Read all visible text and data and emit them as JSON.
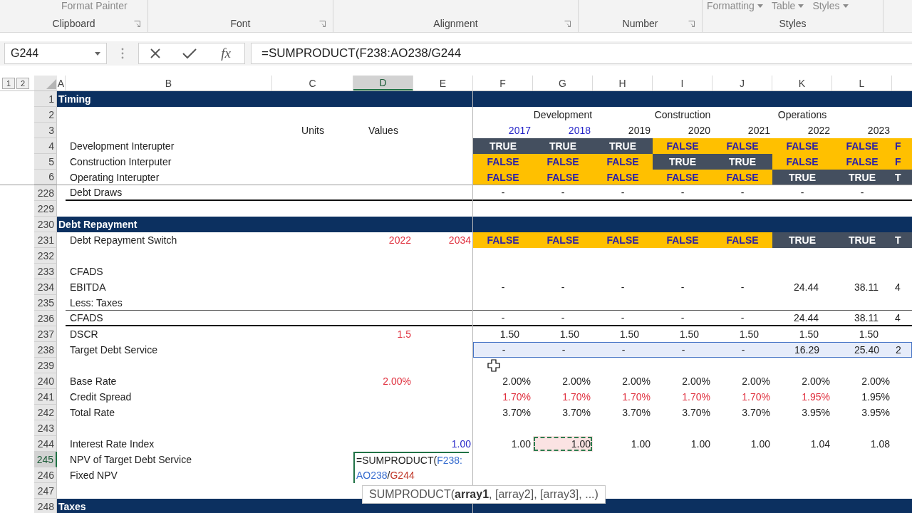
{
  "ribbon": {
    "groups": [
      {
        "label": "Clipboard",
        "launcher": true,
        "items": [
          {
            "label": "Format Painter",
            "dropdown": false
          }
        ]
      },
      {
        "label": "Font",
        "launcher": true
      },
      {
        "label": "Alignment",
        "launcher": true
      },
      {
        "label": "Number",
        "launcher": true
      },
      {
        "label": "Styles",
        "launcher": false,
        "items": [
          {
            "label": "Formatting",
            "dropdown": true
          },
          {
            "label": "Table",
            "dropdown": true
          },
          {
            "label": "Styles",
            "dropdown": true
          }
        ]
      }
    ]
  },
  "formula_bar": {
    "name_box": "G244",
    "function_label": "fx",
    "formula": "=SUMPRODUCT(F238:AO238/G244"
  },
  "outline_levels": [
    "1",
    "2"
  ],
  "columns": [
    {
      "label": "A",
      "selected": false
    },
    {
      "label": "B",
      "selected": false
    },
    {
      "label": "C",
      "selected": false
    },
    {
      "label": "D",
      "selected": true
    },
    {
      "label": "E",
      "selected": false
    },
    {
      "label": "F",
      "selected": false
    },
    {
      "label": "G",
      "selected": false
    },
    {
      "label": "H",
      "selected": false
    },
    {
      "label": "I",
      "selected": false
    },
    {
      "label": "J",
      "selected": false
    },
    {
      "label": "K",
      "selected": false
    },
    {
      "label": "L",
      "selected": false
    }
  ],
  "rows": [
    {
      "number": "1",
      "kind": "section",
      "label": "Timing",
      "selected": false,
      "in_range": false
    },
    {
      "number": "2",
      "kind": "phases",
      "selected": false,
      "in_range": false,
      "phases": [
        "Development",
        "Construction",
        "Operations"
      ]
    },
    {
      "number": "3",
      "kind": "data",
      "units": "Units",
      "d": {
        "text": "Values",
        "kind": "plain"
      },
      "selected": false,
      "in_range": false,
      "values": [
        {
          "text": "2017",
          "kind": "link"
        },
        {
          "text": "2018",
          "kind": "link"
        },
        {
          "text": "2019",
          "kind": "plain"
        },
        {
          "text": "2020",
          "kind": "plain"
        },
        {
          "text": "2021",
          "kind": "plain"
        },
        {
          "text": "2022",
          "kind": "plain"
        },
        {
          "text": "2023",
          "kind": "plain"
        }
      ]
    },
    {
      "number": "4",
      "kind": "data",
      "label": "Development Interupter",
      "selected": false,
      "in_range": false,
      "values": [
        {
          "text": "TRUE",
          "kind": "on"
        },
        {
          "text": "TRUE",
          "kind": "on"
        },
        {
          "text": "TRUE",
          "kind": "on"
        },
        {
          "text": "FALSE",
          "kind": "off"
        },
        {
          "text": "FALSE",
          "kind": "off"
        },
        {
          "text": "FALSE",
          "kind": "off"
        },
        {
          "text": "FALSE",
          "kind": "off"
        },
        {
          "text": "F",
          "kind": "off"
        }
      ]
    },
    {
      "number": "5",
      "kind": "data",
      "label": "Construction Interputer",
      "selected": false,
      "in_range": false,
      "values": [
        {
          "text": "FALSE",
          "kind": "off"
        },
        {
          "text": "FALSE",
          "kind": "off"
        },
        {
          "text": "FALSE",
          "kind": "off"
        },
        {
          "text": "TRUE",
          "kind": "on"
        },
        {
          "text": "TRUE",
          "kind": "on"
        },
        {
          "text": "FALSE",
          "kind": "off"
        },
        {
          "text": "FALSE",
          "kind": "off"
        },
        {
          "text": "F",
          "kind": "off"
        }
      ]
    },
    {
      "number": "6",
      "kind": "data",
      "label": "Operating Interupter",
      "selected": false,
      "in_range": false,
      "values": [
        {
          "text": "FALSE",
          "kind": "off"
        },
        {
          "text": "FALSE",
          "kind": "off"
        },
        {
          "text": "FALSE",
          "kind": "off"
        },
        {
          "text": "FALSE",
          "kind": "off"
        },
        {
          "text": "FALSE",
          "kind": "off"
        },
        {
          "text": "TRUE",
          "kind": "on"
        },
        {
          "text": "TRUE",
          "kind": "on"
        },
        {
          "text": "T",
          "kind": "on"
        }
      ]
    },
    {
      "number": "228",
      "kind": "total",
      "label": "Debt Draws",
      "selected": false,
      "in_range": false,
      "values": [
        {
          "text": "-",
          "kind": "nil"
        },
        {
          "text": "-",
          "kind": "nil"
        },
        {
          "text": "-",
          "kind": "nil"
        },
        {
          "text": "-",
          "kind": "nil"
        },
        {
          "text": "-",
          "kind": "nil"
        },
        {
          "text": "-",
          "kind": "nil"
        },
        {
          "text": "-",
          "kind": "nil"
        }
      ]
    },
    {
      "number": "229",
      "kind": "data",
      "selected": false,
      "in_range": false
    },
    {
      "number": "230",
      "kind": "section",
      "label": "Debt Repayment",
      "selected": false,
      "in_range": false
    },
    {
      "number": "231",
      "kind": "data",
      "label": "Debt Repayment Switch",
      "d": {
        "text": "2022",
        "kind": "input"
      },
      "e": {
        "text": "2034",
        "kind": "input"
      },
      "selected": false,
      "in_range": false,
      "values": [
        {
          "text": "FALSE",
          "kind": "off"
        },
        {
          "text": "FALSE",
          "kind": "off"
        },
        {
          "text": "FALSE",
          "kind": "off"
        },
        {
          "text": "FALSE",
          "kind": "off"
        },
        {
          "text": "FALSE",
          "kind": "off"
        },
        {
          "text": "TRUE",
          "kind": "on"
        },
        {
          "text": "TRUE",
          "kind": "on"
        },
        {
          "text": "T",
          "kind": "on"
        }
      ]
    },
    {
      "number": "232",
      "kind": "data",
      "selected": false,
      "in_range": false
    },
    {
      "number": "233",
      "kind": "data",
      "label": "CFADS",
      "selected": false,
      "in_range": false
    },
    {
      "number": "234",
      "kind": "data",
      "label": "EBITDA",
      "selected": false,
      "in_range": false,
      "values": [
        {
          "text": "-",
          "kind": "nil"
        },
        {
          "text": "-",
          "kind": "nil"
        },
        {
          "text": "-",
          "kind": "nil"
        },
        {
          "text": "-",
          "kind": "nil"
        },
        {
          "text": "-",
          "kind": "nil"
        },
        {
          "text": "24.44",
          "kind": "num"
        },
        {
          "text": "38.11",
          "kind": "num"
        },
        {
          "text": "4",
          "kind": "num"
        }
      ]
    },
    {
      "number": "235",
      "kind": "subtotal",
      "label": "Less: Taxes",
      "selected": false,
      "in_range": false
    },
    {
      "number": "236",
      "kind": "total",
      "label": "CFADS",
      "selected": false,
      "in_range": false,
      "values": [
        {
          "text": "-",
          "kind": "nil"
        },
        {
          "text": "-",
          "kind": "nil"
        },
        {
          "text": "-",
          "kind": "nil"
        },
        {
          "text": "-",
          "kind": "nil"
        },
        {
          "text": "-",
          "kind": "nil"
        },
        {
          "text": "24.44",
          "kind": "num"
        },
        {
          "text": "38.11",
          "kind": "num"
        },
        {
          "text": "4",
          "kind": "num"
        }
      ]
    },
    {
      "number": "237",
      "kind": "data",
      "label": "DSCR",
      "d": {
        "text": "1.5",
        "kind": "input"
      },
      "selected": false,
      "in_range": false,
      "values": [
        {
          "text": "1.50",
          "kind": "num"
        },
        {
          "text": "1.50",
          "kind": "num"
        },
        {
          "text": "1.50",
          "kind": "num"
        },
        {
          "text": "1.50",
          "kind": "num"
        },
        {
          "text": "1.50",
          "kind": "num"
        },
        {
          "text": "1.50",
          "kind": "num"
        },
        {
          "text": "1.50",
          "kind": "num"
        }
      ]
    },
    {
      "number": "238",
      "kind": "data",
      "label": "Target Debt Service",
      "selected": false,
      "in_range": true,
      "values": [
        {
          "text": "-",
          "kind": "nil"
        },
        {
          "text": "-",
          "kind": "nil"
        },
        {
          "text": "-",
          "kind": "nil"
        },
        {
          "text": "-",
          "kind": "nil"
        },
        {
          "text": "-",
          "kind": "nil"
        },
        {
          "text": "16.29",
          "kind": "num"
        },
        {
          "text": "25.40",
          "kind": "num"
        },
        {
          "text": "2",
          "kind": "num"
        }
      ]
    },
    {
      "number": "239",
      "kind": "data",
      "selected": false,
      "in_range": false
    },
    {
      "number": "240",
      "kind": "data",
      "label": "Base Rate",
      "d": {
        "text": "2.00%",
        "kind": "input"
      },
      "selected": false,
      "in_range": false,
      "values": [
        {
          "text": "2.00%",
          "kind": "plain"
        },
        {
          "text": "2.00%",
          "kind": "plain"
        },
        {
          "text": "2.00%",
          "kind": "plain"
        },
        {
          "text": "2.00%",
          "kind": "plain"
        },
        {
          "text": "2.00%",
          "kind": "plain"
        },
        {
          "text": "2.00%",
          "kind": "plain"
        },
        {
          "text": "2.00%",
          "kind": "plain"
        }
      ]
    },
    {
      "number": "241",
      "kind": "data",
      "label": "Credit Spread",
      "selected": false,
      "in_range": false,
      "values": [
        {
          "text": "1.70%",
          "kind": "input"
        },
        {
          "text": "1.70%",
          "kind": "input"
        },
        {
          "text": "1.70%",
          "kind": "input"
        },
        {
          "text": "1.70%",
          "kind": "input"
        },
        {
          "text": "1.70%",
          "kind": "input"
        },
        {
          "text": "1.95%",
          "kind": "input"
        },
        {
          "text": "1.95%",
          "kind": "plain"
        }
      ]
    },
    {
      "number": "242",
      "kind": "data",
      "label": "Total Rate",
      "selected": false,
      "in_range": false,
      "values": [
        {
          "text": "3.70%",
          "kind": "plain"
        },
        {
          "text": "3.70%",
          "kind": "plain"
        },
        {
          "text": "3.70%",
          "kind": "plain"
        },
        {
          "text": "3.70%",
          "kind": "plain"
        },
        {
          "text": "3.70%",
          "kind": "plain"
        },
        {
          "text": "3.95%",
          "kind": "plain"
        },
        {
          "text": "3.95%",
          "kind": "plain"
        }
      ]
    },
    {
      "number": "243",
      "kind": "data",
      "selected": false,
      "in_range": false
    },
    {
      "number": "244",
      "kind": "data",
      "label": "Interest Rate Index",
      "e": {
        "text": "1.00",
        "kind": "link"
      },
      "selected": false,
      "in_range": false,
      "values": [
        {
          "text": "1.00",
          "kind": "plain"
        },
        {
          "text": "1.00",
          "kind": "copy_ref"
        },
        {
          "text": "1.00",
          "kind": "plain"
        },
        {
          "text": "1.00",
          "kind": "plain"
        },
        {
          "text": "1.00",
          "kind": "plain"
        },
        {
          "text": "1.04",
          "kind": "plain"
        },
        {
          "text": "1.08",
          "kind": "plain"
        }
      ]
    },
    {
      "number": "245",
      "kind": "data",
      "label": "NPV of Target Debt Service",
      "selected": true,
      "in_range": false
    },
    {
      "number": "246",
      "kind": "data",
      "label": "Fixed NPV",
      "selected": false,
      "in_range": false
    },
    {
      "number": "247",
      "kind": "data",
      "selected": false,
      "in_range": false
    },
    {
      "number": "248",
      "kind": "section",
      "label": "Taxes",
      "selected": false,
      "in_range": false
    }
  ],
  "cell_editor": {
    "lines": [
      [
        {
          "text": "=SUMPRODUCT(",
          "kind": "plain"
        },
        {
          "text": "F238:",
          "kind": "ref1"
        }
      ],
      [
        {
          "text": "AO238",
          "kind": "ref1"
        },
        {
          "text": "/",
          "kind": "plain"
        },
        {
          "text": "G244",
          "kind": "ref2"
        }
      ]
    ],
    "tooltip": "SUMPRODUCT(**array1**, [array2], [array3], ...)"
  }
}
